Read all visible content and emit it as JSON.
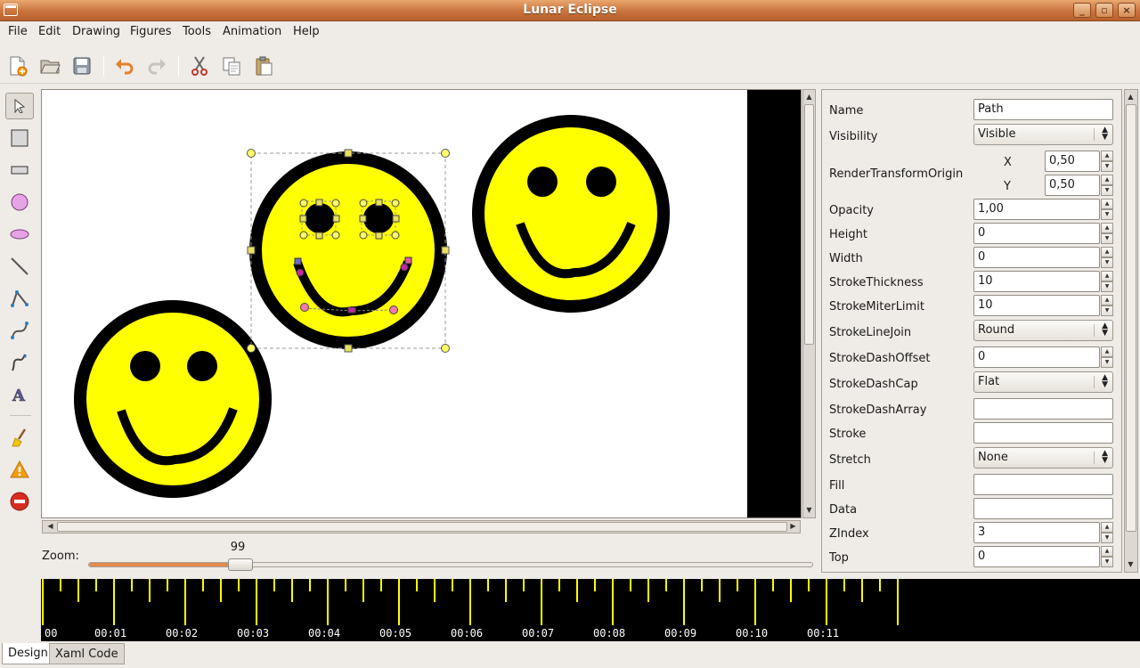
{
  "window": {
    "title": "Lunar Eclipse"
  },
  "menu": [
    "File",
    "Edit",
    "Drawing",
    "Figures",
    "Tools",
    "Animation",
    "Help"
  ],
  "toolbar": {
    "buttons": [
      "new-document-icon",
      "open-folder-icon",
      "save-icon",
      "undo-icon",
      "redo-icon",
      "cut-icon",
      "copy-icon",
      "paste-icon"
    ]
  },
  "tools": [
    "select-arrow-icon",
    "rectangle-icon",
    "rounded-rectangle-icon",
    "circle-icon",
    "ellipse-icon",
    "line-icon",
    "polyline-icon",
    "bezier-icon",
    "freehand-pen-icon",
    "text-icon",
    "broom-icon",
    "warning-icon",
    "stop-icon"
  ],
  "zoom": {
    "label": "Zoom:",
    "value": "99",
    "fraction": 0.2
  },
  "properties": {
    "name": {
      "label": "Name",
      "value": "Path"
    },
    "visibility": {
      "label": "Visibility",
      "value": "Visible"
    },
    "render_transform_origin": {
      "label": "RenderTransformOrigin",
      "x_label": "X",
      "x_value": "0,50",
      "y_label": "Y",
      "y_value": "0,50"
    },
    "opacity": {
      "label": "Opacity",
      "value": "1,00"
    },
    "height": {
      "label": "Height",
      "value": "0"
    },
    "width": {
      "label": "Width",
      "value": "0"
    },
    "stroke_thickness": {
      "label": "StrokeThickness",
      "value": "10"
    },
    "stroke_miter_limit": {
      "label": "StrokeMiterLimit",
      "value": "10"
    },
    "stroke_line_join": {
      "label": "StrokeLineJoin",
      "value": "Round"
    },
    "stroke_dash_offset": {
      "label": "StrokeDashOffset",
      "value": "0"
    },
    "stroke_dash_cap": {
      "label": "StrokeDashCap",
      "value": "Flat"
    },
    "stroke_dash_array": {
      "label": "StrokeDashArray",
      "value": ""
    },
    "stroke": {
      "label": "Stroke",
      "value": ""
    },
    "stretch": {
      "label": "Stretch",
      "value": "None"
    },
    "fill": {
      "label": "Fill",
      "value": ""
    },
    "data": {
      "label": "Data",
      "value": ""
    },
    "zindex": {
      "label": "ZIndex",
      "value": "3"
    },
    "top": {
      "label": "Top",
      "value": "0"
    }
  },
  "timeline": {
    "labels": [
      "00",
      "00:01",
      "00:02",
      "00:03",
      "00:04",
      "00:05",
      "00:06",
      "00:07",
      "00:08",
      "00:09",
      "00:10",
      "00:11"
    ]
  },
  "tabs": [
    "Design",
    "Xaml Code"
  ],
  "colors": {
    "smiley_fill": "#ffff00",
    "smiley_stroke": "#000000",
    "title_bar": "#c9733d",
    "zoom_fill": "#e58a4e",
    "timeline_tick": "#ffff00"
  }
}
